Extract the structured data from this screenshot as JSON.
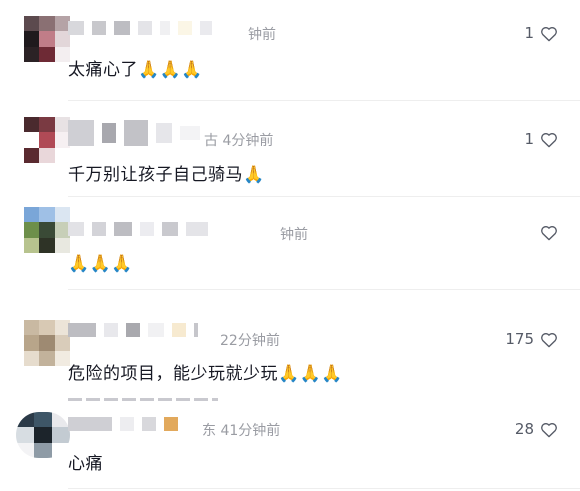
{
  "comments": [
    {
      "time": "钟前",
      "text": "太痛心了🙏🙏🙏",
      "likes": "1",
      "heart_icon": "heart-outline-icon"
    },
    {
      "time": "古 4分钟前",
      "text": "千万别让孩子自己骑马🙏",
      "likes": "1",
      "heart_icon": "heart-outline-icon"
    },
    {
      "time": "钟前",
      "text": "🙏🙏🙏",
      "likes": "",
      "heart_icon": "heart-outline-icon"
    },
    {
      "time": "22分钟前",
      "text": "危险的项目，能少玩就少玩🙏🙏🙏",
      "likes": "175",
      "heart_icon": "heart-outline-icon"
    },
    {
      "time": "东 41分钟前",
      "text": "心痛",
      "likes": "28",
      "heart_icon": "heart-outline-icon"
    }
  ],
  "colors": {
    "text": "#161823",
    "meta": "#9a9ca3",
    "divider": "#eeeeee",
    "heart": "#555a66"
  }
}
